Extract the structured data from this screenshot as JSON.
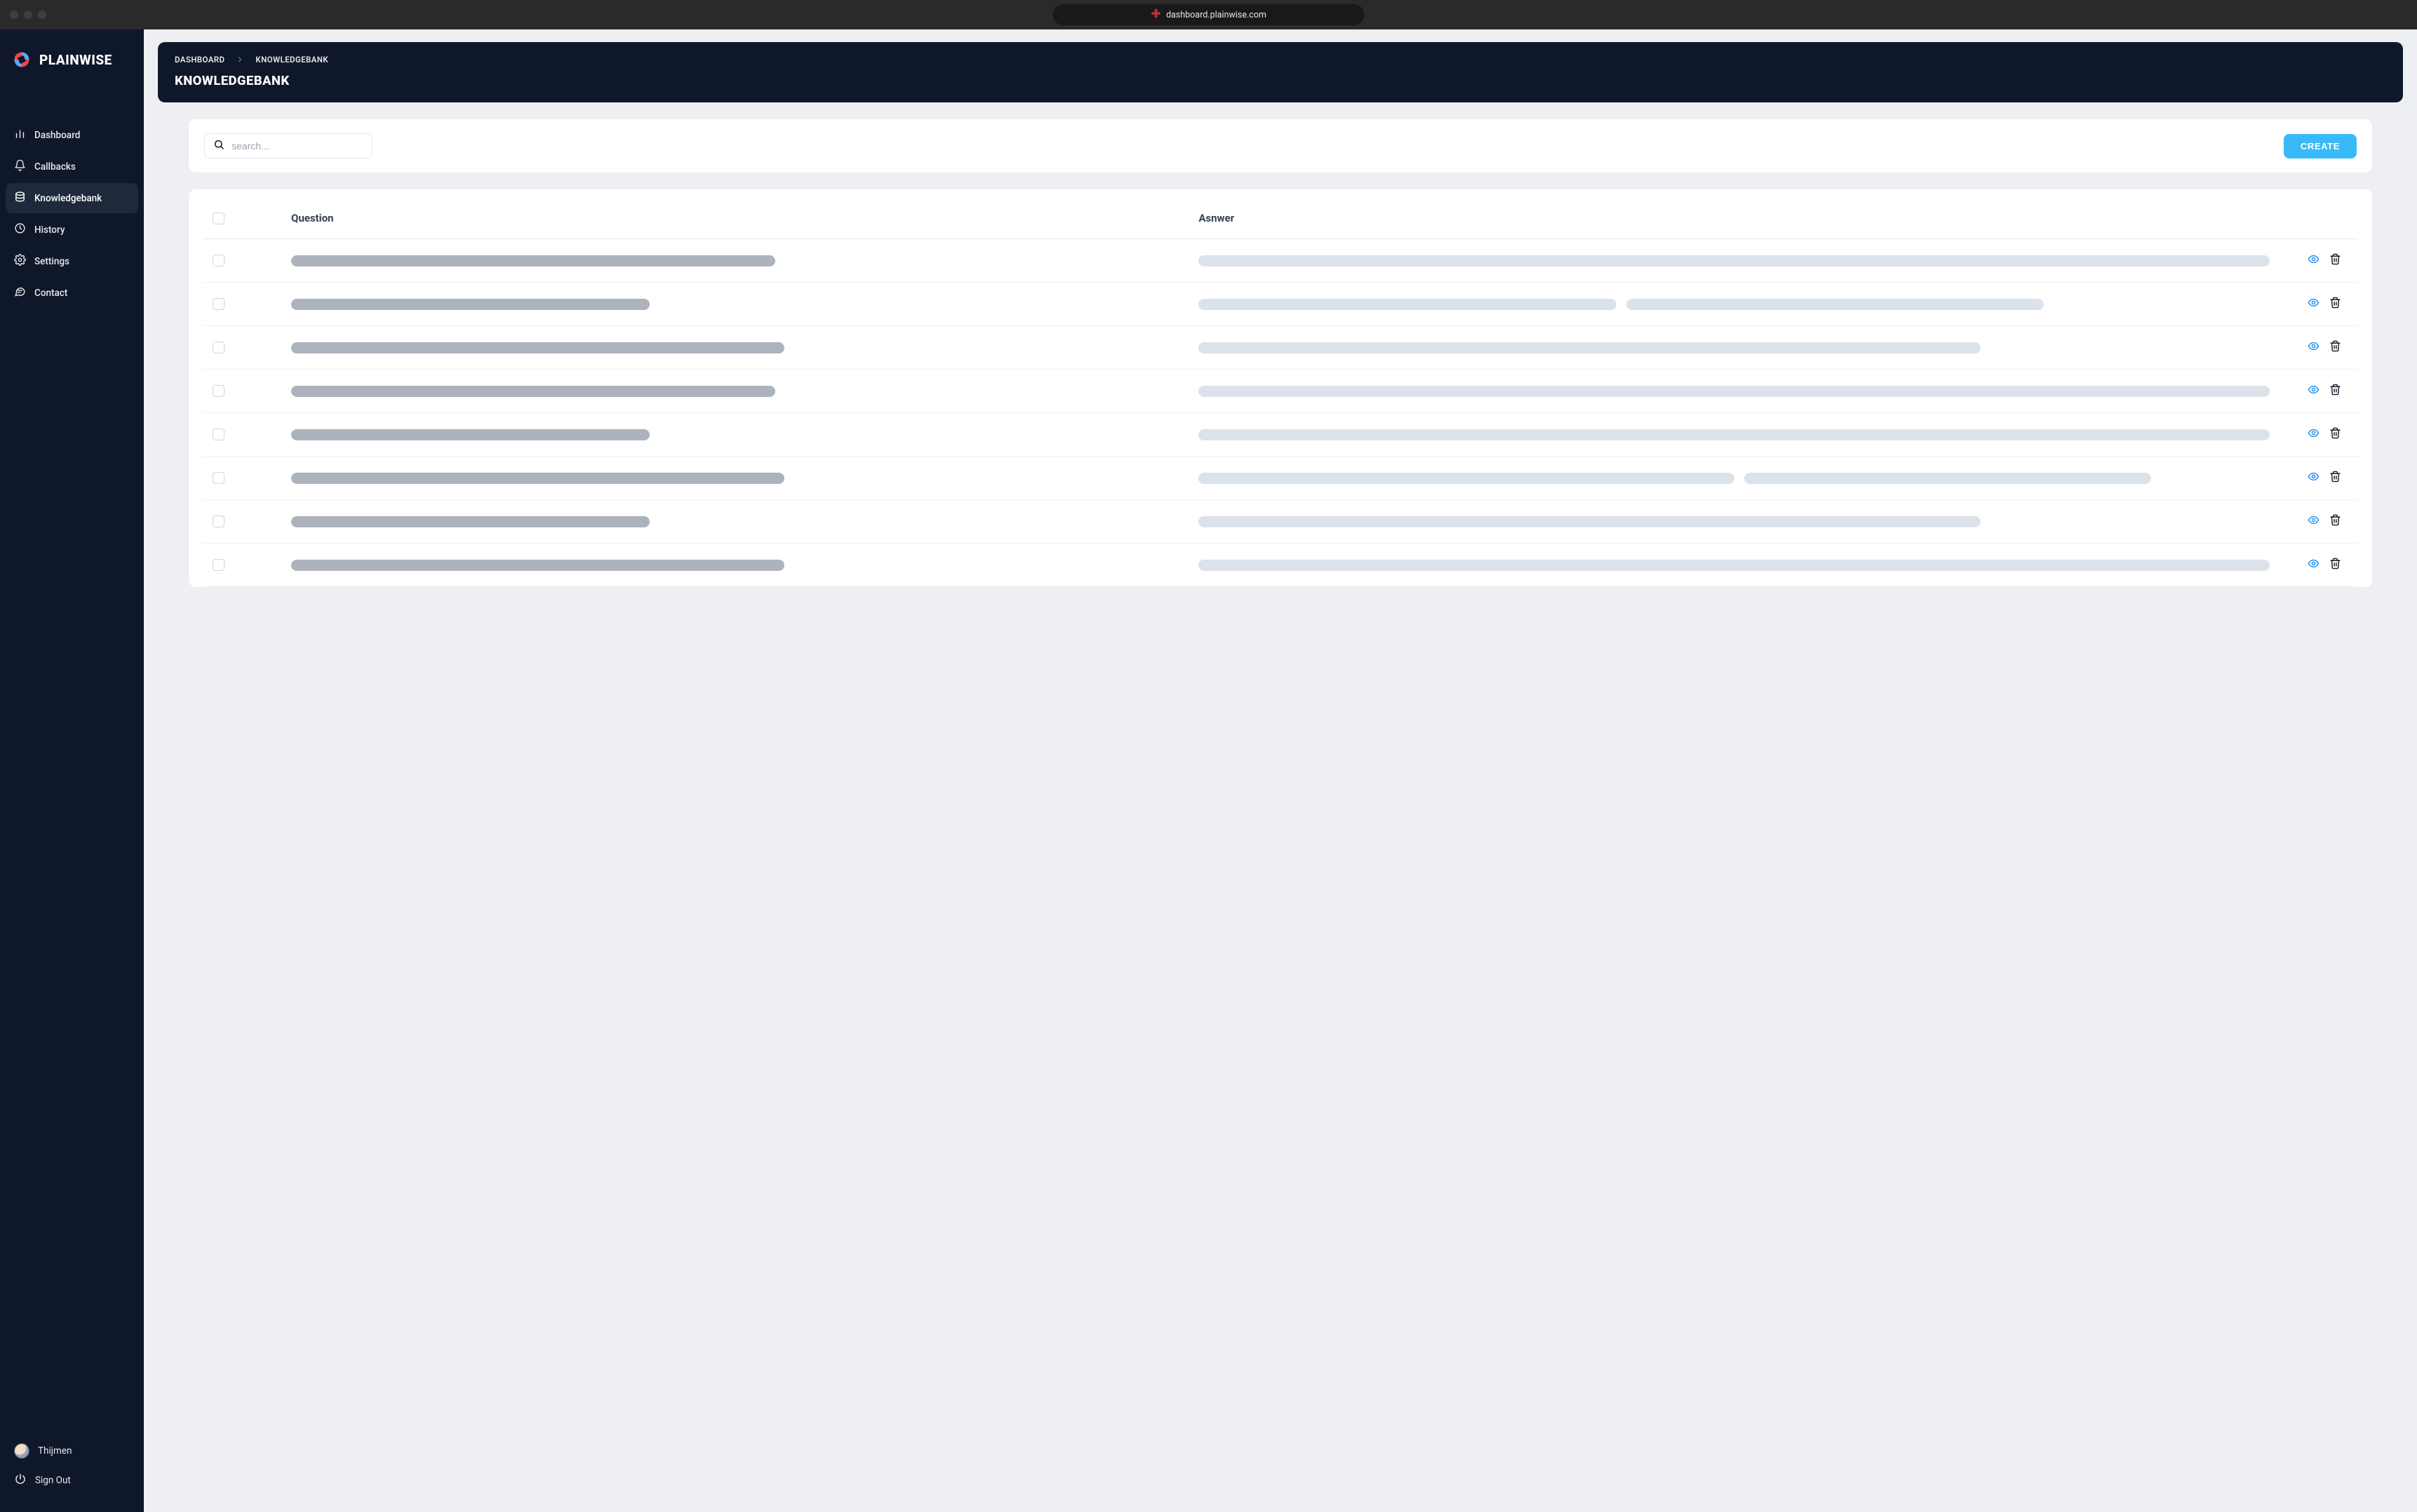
{
  "browser": {
    "url": "dashboard.plainwise.com"
  },
  "brand": {
    "name": "PLAINWISE"
  },
  "sidebar": {
    "items": [
      {
        "label": "Dashboard",
        "icon": "bar-chart-icon",
        "active": false
      },
      {
        "label": "Callbacks",
        "icon": "bell-icon",
        "active": false
      },
      {
        "label": "Knowledgebank",
        "icon": "database-icon",
        "active": true
      },
      {
        "label": "History",
        "icon": "clock-icon",
        "active": false
      },
      {
        "label": "Settings",
        "icon": "gear-icon",
        "active": false
      },
      {
        "label": "Contact",
        "icon": "chat-icon",
        "active": false
      }
    ],
    "user_name": "Thijmen",
    "signout_label": "Sign Out"
  },
  "header": {
    "breadcrumbs": [
      "DASHBOARD",
      "KNOWLEDGEBANK"
    ],
    "title": "KNOWLEDGEBANK"
  },
  "toolbar": {
    "search_placeholder": "search...",
    "search_value": "",
    "create_label": "CREATE"
  },
  "table": {
    "columns": [
      "Question",
      "Asnwer"
    ],
    "rows": [
      {
        "q_width": 54,
        "a_segments": [
          100
        ]
      },
      {
        "q_width": 40,
        "a_segments": [
          39,
          39
        ]
      },
      {
        "q_width": 55,
        "a_segments": [
          73
        ]
      },
      {
        "q_width": 54,
        "a_segments": [
          100
        ]
      },
      {
        "q_width": 40,
        "a_segments": [
          100
        ]
      },
      {
        "q_width": 55,
        "a_segments": [
          50,
          38
        ]
      },
      {
        "q_width": 40,
        "a_segments": [
          73
        ]
      },
      {
        "q_width": 55,
        "a_segments": [
          100
        ]
      }
    ]
  },
  "colors": {
    "sidebar_bg": "#0f172a",
    "accent": "#38baf8",
    "eye_icon": "#1b90f0"
  }
}
